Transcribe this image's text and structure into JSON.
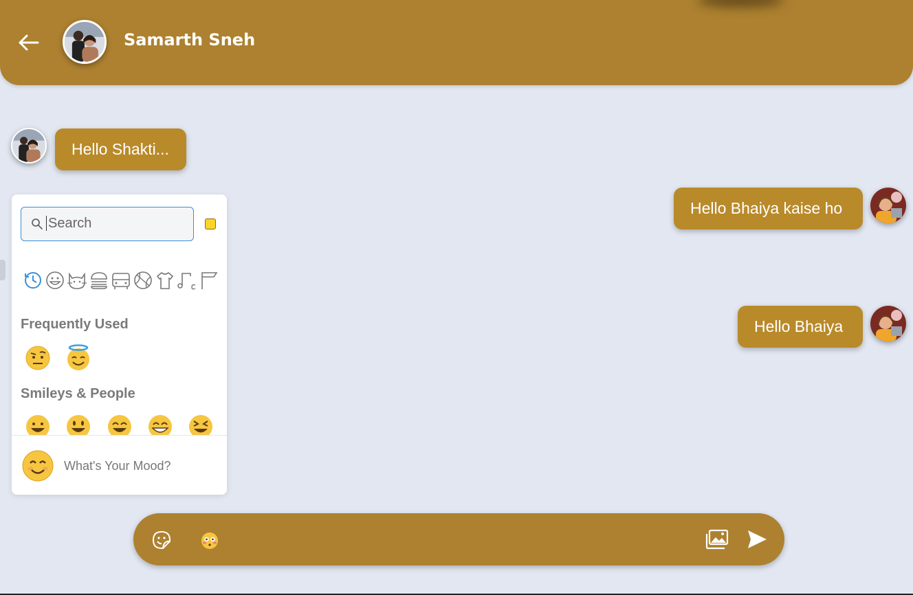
{
  "header": {
    "back_icon": "arrow-left-icon",
    "contact_name": "Samarth Sneh"
  },
  "messages": [
    {
      "direction": "received",
      "text": "Hello Shakti..."
    },
    {
      "direction": "sent",
      "text": "Hello Bhaiya kaise ho"
    },
    {
      "direction": "sent",
      "text": "Hello Bhaiya"
    }
  ],
  "emoji_picker": {
    "search_placeholder": "Search",
    "skin_tone_color": "#fcd42a",
    "categories": [
      "recent-icon",
      "smileys-icon",
      "animals-icon",
      "food-icon",
      "travel-icon",
      "activity-icon",
      "objects-icon",
      "symbols-icon",
      "flags-icon"
    ],
    "sections": [
      {
        "title": "Frequently Used",
        "emojis": [
          "face-with-raised-eyebrow",
          "smiling-face-with-halo"
        ]
      },
      {
        "title": "Smileys & People",
        "emojis": [
          "grinning-face",
          "grinning-face-big-eyes",
          "grinning-face-smiling-eyes",
          "beaming-face",
          "grinning-squinting-face"
        ]
      }
    ],
    "footer_placeholder": "What's Your Mood?"
  },
  "composer": {
    "icons": [
      "sticker-icon",
      "emoji-icon",
      "gallery-icon",
      "send-icon"
    ]
  },
  "colors": {
    "accent": "#ad8130",
    "bubble": "#b98a2a",
    "background": "#e2e7f1",
    "search_border": "#3b8fd8"
  }
}
